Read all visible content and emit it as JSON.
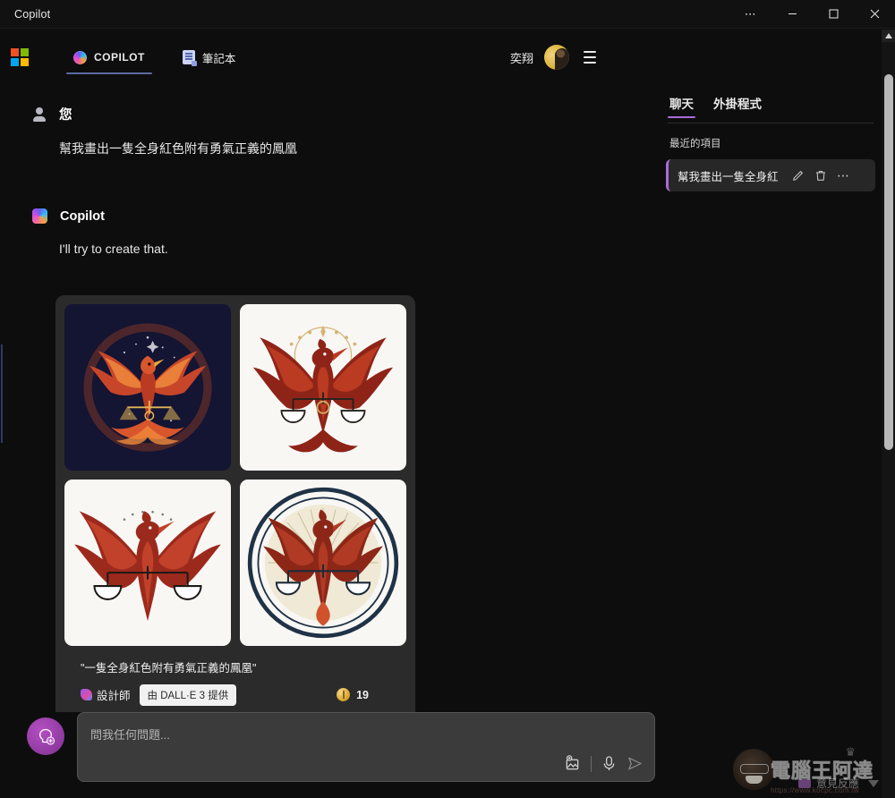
{
  "window": {
    "title": "Copilot",
    "controls": {
      "more": "more-options",
      "minimize": "minimize",
      "maximize": "maximize",
      "close": "close"
    }
  },
  "header": {
    "logo": "microsoft-logo",
    "tabs": [
      {
        "label": "COPILOT",
        "icon": "copilot-icon",
        "active": true
      },
      {
        "label": "筆記本",
        "icon": "notebook-icon",
        "active": false
      }
    ],
    "user_name": "奕翔",
    "avatar": "user-avatar",
    "menu": "hamburger-menu"
  },
  "conversation": {
    "messages": [
      {
        "role": "user",
        "name": "您",
        "text": "幫我畫出一隻全身紅色附有勇氣正義的鳳凰"
      },
      {
        "role": "assistant",
        "name": "Copilot",
        "text": "I'll try to create that."
      }
    ]
  },
  "image_card": {
    "images": [
      {
        "alt": "phoenix-scales-dark-navy",
        "bg": "#141432"
      },
      {
        "alt": "phoenix-scales-white-gold",
        "bg": "#f7f6f3"
      },
      {
        "alt": "phoenix-scales-white-plain",
        "bg": "#f7f6f3"
      },
      {
        "alt": "phoenix-scales-emblem-circle",
        "bg": "#f7f6f3"
      }
    ],
    "caption": "\"一隻全身紅色附有勇氣正義的鳳凰\"",
    "designer_label": "設計師",
    "powered_by": "由 DALL·E 3 提供",
    "credits": "19",
    "credits_icon": "coin-icon"
  },
  "composer": {
    "placeholder": "問我任何問題...",
    "plugin_button": "plugin-add-icon",
    "actions": [
      {
        "name": "add-image-icon"
      },
      {
        "name": "microphone-icon"
      },
      {
        "name": "send-icon"
      }
    ]
  },
  "right_panel": {
    "tabs": [
      {
        "label": "聊天",
        "active": true
      },
      {
        "label": "外掛程式",
        "active": false
      }
    ],
    "recent_label": "最近的項目",
    "recent_items": [
      {
        "title": "幫我畫出一隻全身紅",
        "actions": [
          "edit-icon",
          "delete-icon",
          "more-icon"
        ]
      }
    ]
  },
  "footer": {
    "feedback_label": "意見反應"
  },
  "watermark": {
    "text": "電腦王阿達",
    "url": "https://www.kocpc.com.tw"
  },
  "colors": {
    "accent_purple": "#a86cd8",
    "accent_blue": "#5a6a9e",
    "window_bg": "#0d0d0d",
    "card_bg": "#2b2b2b"
  }
}
